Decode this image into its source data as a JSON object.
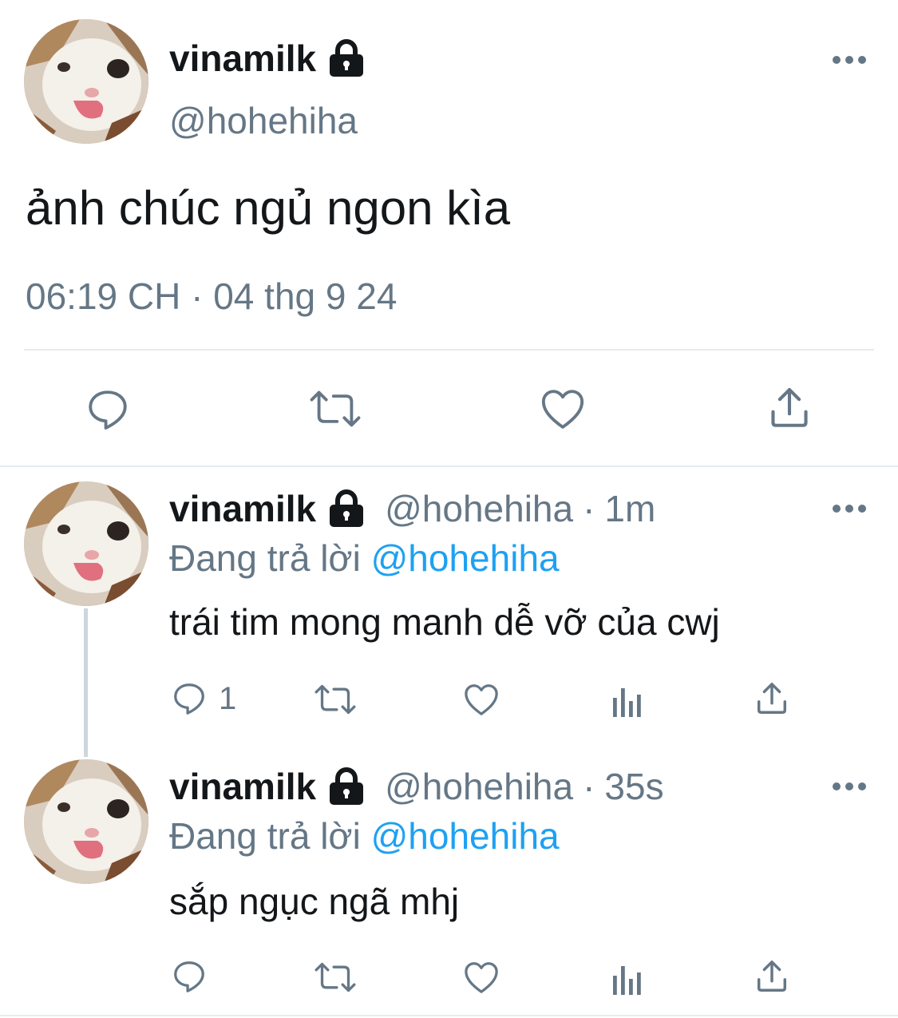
{
  "main_tweet": {
    "display_name": "vinamilk",
    "handle": "@hohehiha",
    "text": "ảnh chúc ngủ ngon kìa",
    "timestamp": "06:19 CH · 04 thg 9 24"
  },
  "replies": [
    {
      "display_name": "vinamilk",
      "handle": "@hohehiha",
      "separator": "·",
      "time": "1m",
      "reply_prefix": "Đang trả lời",
      "reply_mention": "@hohehiha",
      "text": "trái tim mong manh dễ vỡ của cwj",
      "reply_count": "1"
    },
    {
      "display_name": "vinamilk",
      "handle": "@hohehiha",
      "separator": "·",
      "time": "35s",
      "reply_prefix": "Đang trả lời",
      "reply_mention": "@hohehiha",
      "text": "sắp ngục ngã mhj",
      "reply_count": ""
    }
  ],
  "icons": {
    "reply": "reply-icon",
    "retweet": "retweet-icon",
    "like": "heart-icon",
    "analytics": "analytics-icon",
    "share": "share-icon",
    "lock": "lock-icon",
    "more": "more-icon"
  },
  "colors": {
    "text": "#14171a",
    "secondary": "#657786",
    "mention": "#1da1f2",
    "divider": "#e6ecf0",
    "thread_line": "#ccd6dd"
  }
}
